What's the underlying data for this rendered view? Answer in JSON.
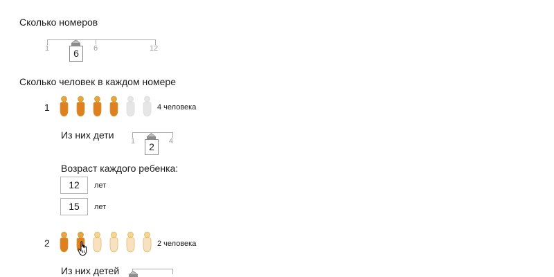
{
  "rooms_label": "Сколько номеров",
  "rooms_slider": {
    "min_label": "1",
    "mid_label": "6",
    "max_label": "12",
    "value": "6"
  },
  "people_label": "Сколько человек в каждом номере",
  "rooms": [
    {
      "number": "1",
      "people_text": "4 человека",
      "filled_people": 4,
      "total_icons": 6,
      "children_label": "Из них дети",
      "children_slider": {
        "min_label": "1",
        "max_label": "4",
        "value": "2"
      },
      "ages_label": "Возраст каждого ребенка:",
      "ages": [
        {
          "value": "12",
          "unit": "лет"
        },
        {
          "value": "15",
          "unit": "лет"
        }
      ]
    },
    {
      "number": "2",
      "people_text": "2 человека",
      "filled_people": 2,
      "total_icons": 6,
      "children_label": "Из них детей"
    }
  ],
  "colors": {
    "person_filled": "#e07f1e",
    "person_empty": "#e6e6e6",
    "person_hover": "#f6e2c0"
  },
  "icons": {
    "person": "person-icon",
    "slider_thumb": "slider-thumb-icon",
    "cursor": "hand-cursor-icon"
  }
}
